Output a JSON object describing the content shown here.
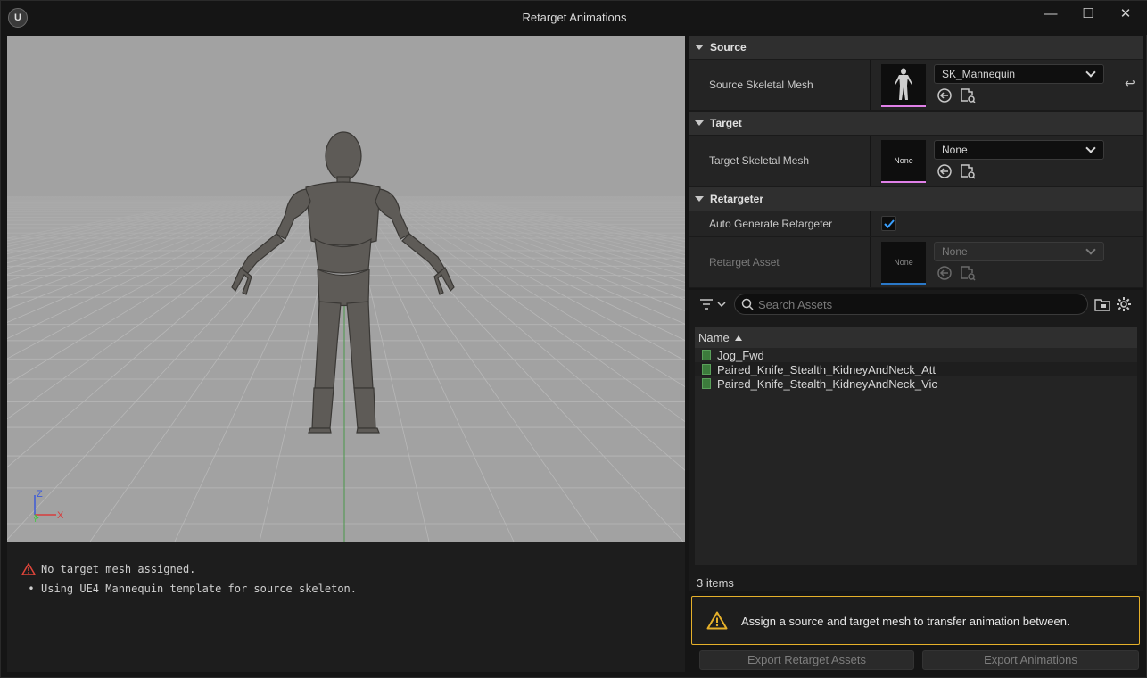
{
  "window": {
    "title": "Retarget Animations",
    "logo": "U"
  },
  "controls": {
    "minimize": "—",
    "maximize": "☐",
    "close": "✕"
  },
  "viewport": {
    "axes": {
      "z": "Z",
      "x": "X",
      "y": "Y"
    }
  },
  "log": {
    "lines": [
      {
        "type": "error",
        "text": "No target mesh assigned."
      },
      {
        "type": "info",
        "text": "Using UE4 Mannequin template for source skeleton."
      }
    ]
  },
  "details": {
    "source": {
      "header": "Source",
      "label": "Source Skeletal Mesh",
      "value": "SK_Mannequin"
    },
    "target": {
      "header": "Target",
      "label": "Target Skeletal Mesh",
      "thumb": "None",
      "value": "None"
    },
    "retargeter": {
      "header": "Retargeter",
      "auto_label": "Auto Generate Retargeter",
      "auto_checked": true,
      "asset_label": "Retarget Asset",
      "asset_thumb": "None",
      "asset_value": "None"
    }
  },
  "browser": {
    "search_placeholder": "Search Assets",
    "column": "Name",
    "items": [
      "Jog_Fwd",
      "Paired_Knife_Stealth_KidneyAndNeck_Att",
      "Paired_Knife_Stealth_KidneyAndNeck_Vic"
    ],
    "count": "3 items"
  },
  "warning": {
    "text": "Assign a source and target mesh to transfer animation between."
  },
  "buttons": {
    "export_assets": "Export Retarget Assets",
    "export_anims": "Export Animations"
  },
  "colors": {
    "warning_border": "#e5b02a",
    "error_red": "#e0453a",
    "mesh_pink": "#e080e8",
    "checkbox_blue": "#3aa0ff"
  }
}
